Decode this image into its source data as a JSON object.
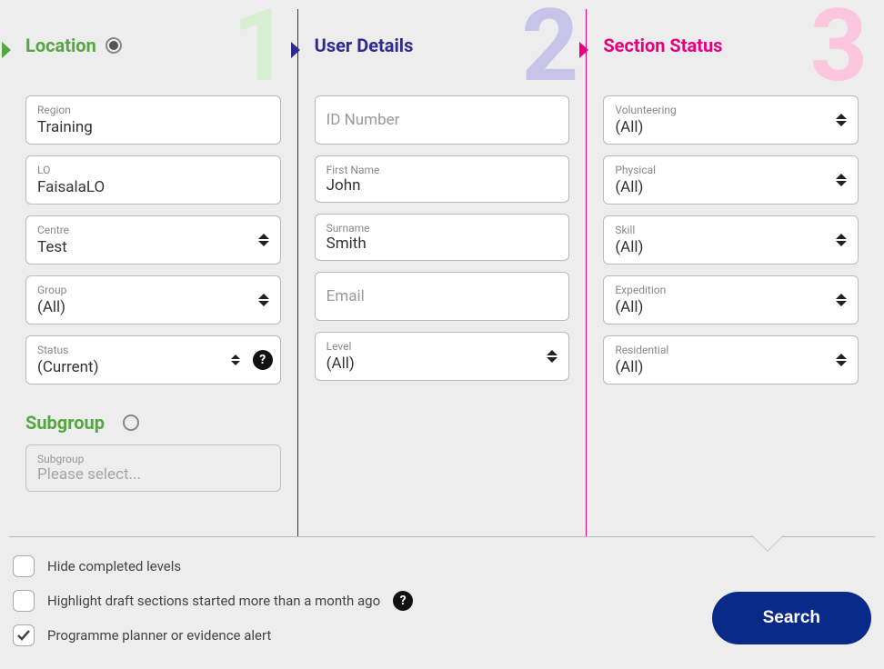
{
  "columns": {
    "location": {
      "num": "1",
      "title": "Location"
    },
    "user": {
      "num": "2",
      "title": "User Details"
    },
    "section": {
      "num": "3",
      "title": "Section Status"
    }
  },
  "location": {
    "region": {
      "label": "Region",
      "value": "Training"
    },
    "lo": {
      "label": "LO",
      "value": "FaisalaLO"
    },
    "centre": {
      "label": "Centre",
      "value": "Test"
    },
    "group": {
      "label": "Group",
      "value": "(All)"
    },
    "status": {
      "label": "Status",
      "value": "(Current)"
    },
    "subgroup_title": "Subgroup",
    "subgroup": {
      "label": "Subgroup",
      "placeholder": "Please select..."
    }
  },
  "user": {
    "id": {
      "placeholder": "ID Number"
    },
    "first": {
      "label": "First Name",
      "value": "John"
    },
    "surname": {
      "label": "Surname",
      "value": "Smith"
    },
    "email": {
      "placeholder": "Email"
    },
    "level": {
      "label": "Level",
      "value": "(All)"
    }
  },
  "section": {
    "volunteering": {
      "label": "Volunteering",
      "value": "(All)"
    },
    "physical": {
      "label": "Physical",
      "value": "(All)"
    },
    "skill": {
      "label": "Skill",
      "value": "(All)"
    },
    "expedition": {
      "label": "Expedition",
      "value": "(All)"
    },
    "residential": {
      "label": "Residential",
      "value": "(All)"
    }
  },
  "footer": {
    "hide_completed": {
      "label": "Hide completed levels",
      "checked": false
    },
    "highlight_draft": {
      "label": "Highlight draft sections started more than a month ago",
      "checked": false
    },
    "programme_alert": {
      "label": "Programme planner or evidence alert",
      "checked": true
    },
    "search": "Search"
  }
}
